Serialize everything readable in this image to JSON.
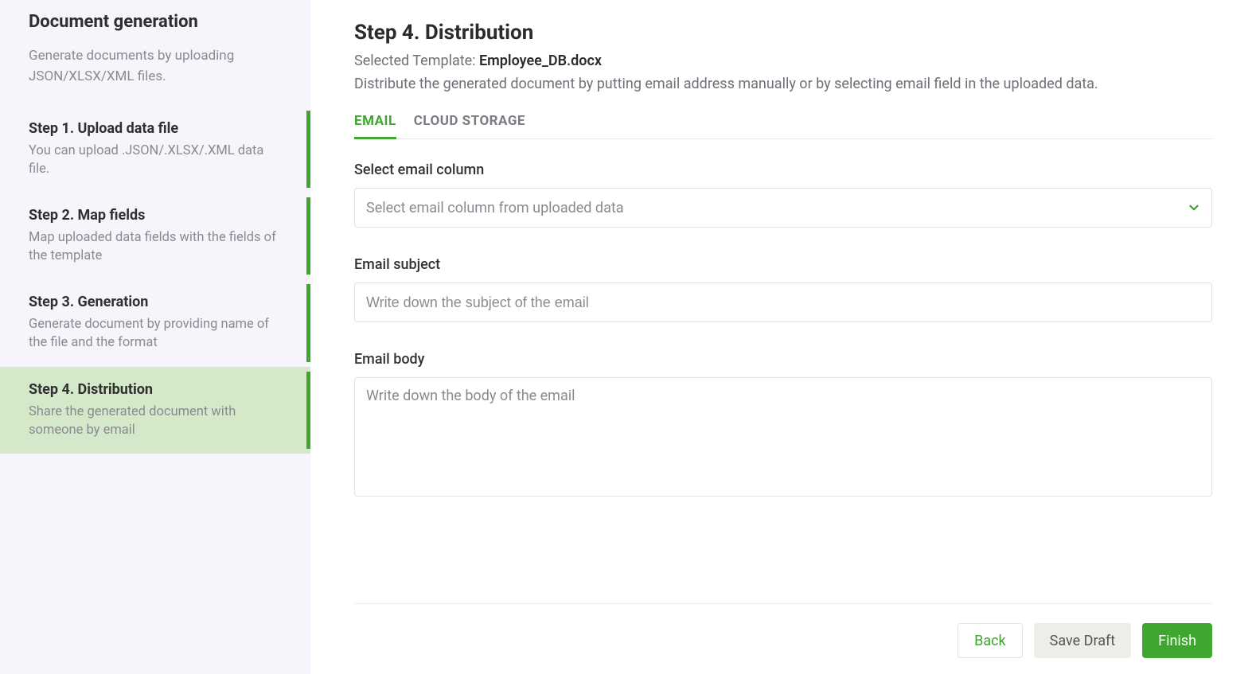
{
  "sidebar": {
    "title": "Document generation",
    "subtitle": "Generate documents by uploading JSON/XLSX/XML files.",
    "steps": [
      {
        "title": "Step 1. Upload data file",
        "desc": "You can upload .JSON/.XLSX/.XML data file.",
        "active": false
      },
      {
        "title": "Step 2. Map fields",
        "desc": "Map uploaded data fields with the fields of the template",
        "active": false
      },
      {
        "title": "Step 3. Generation",
        "desc": "Generate document by providing name of the file and the format",
        "active": false
      },
      {
        "title": "Step 4. Distribution",
        "desc": "Share the generated document with someone by email",
        "active": true
      }
    ]
  },
  "main": {
    "heading": "Step 4. Distribution",
    "template_label": "Selected Template: ",
    "template_name": "Employee_DB.docx",
    "description": "Distribute the generated document by putting email address manually or by selecting email field in the uploaded data.",
    "tabs": [
      {
        "label": "EMAIL",
        "active": true
      },
      {
        "label": "CLOUD STORAGE",
        "active": false
      }
    ],
    "form": {
      "select_label": "Select email column",
      "select_placeholder": "Select email column from uploaded data",
      "subject_label": "Email subject",
      "subject_placeholder": "Write down the subject of the email",
      "body_label": "Email body",
      "body_placeholder": "Write down the body of the email"
    }
  },
  "footer": {
    "back": "Back",
    "save_draft": "Save Draft",
    "finish": "Finish"
  },
  "colors": {
    "accent": "#3fa62f"
  }
}
